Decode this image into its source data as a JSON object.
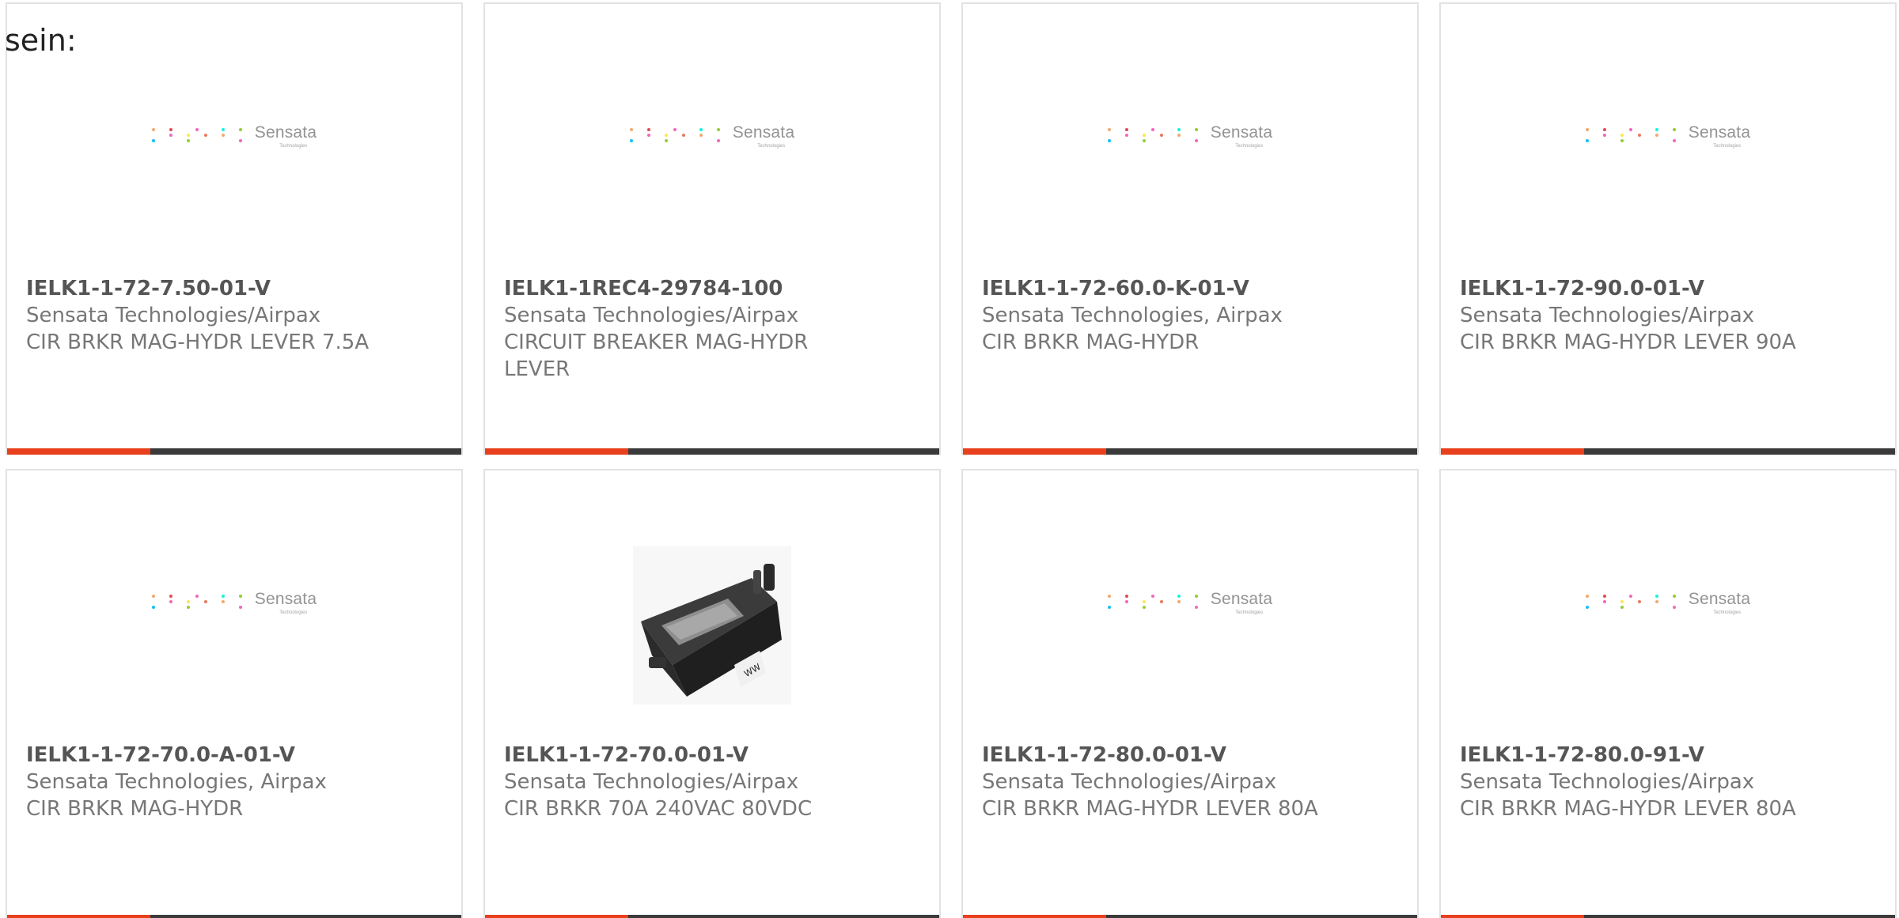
{
  "intro_text": "sein:",
  "brand_logo": {
    "name": "Sensata",
    "subtitle": "Technologies"
  },
  "colors": {
    "accent": "#e8401c",
    "bar": "#3a3a3a",
    "card_border": "#e2e2e2",
    "part_number": "#555555",
    "text_muted": "#777777"
  },
  "products": [
    {
      "part_number": "IELK1-1-72-7.50-01-V",
      "manufacturer": "Sensata Technologies/Airpax",
      "description": "CIR BRKR MAG-HYDR LEVER 7.5A",
      "image": "sensata-logo"
    },
    {
      "part_number": "IELK1-1REC4-29784-100",
      "manufacturer": "Sensata Technologies/Airpax",
      "description": "CIRCUIT BREAKER MAG-HYDR LEVER",
      "image": "sensata-logo"
    },
    {
      "part_number": "IELK1-1-72-60.0-K-01-V",
      "manufacturer": "Sensata Technologies, Airpax",
      "description": "CIR BRKR MAG-HYDR",
      "image": "sensata-logo"
    },
    {
      "part_number": "IELK1-1-72-90.0-01-V",
      "manufacturer": "Sensata Technologies/Airpax",
      "description": "CIR BRKR MAG-HYDR LEVER 90A",
      "image": "sensata-logo"
    },
    {
      "part_number": "IELK1-1-72-70.0-A-01-V",
      "manufacturer": "Sensata Technologies, Airpax",
      "description": "CIR BRKR MAG-HYDR",
      "image": "sensata-logo"
    },
    {
      "part_number": "IELK1-1-72-70.0-01-V",
      "manufacturer": "Sensata Technologies/Airpax",
      "description": "CIR BRKR 70A 240VAC 80VDC",
      "image": "circuit-breaker-photo"
    },
    {
      "part_number": "IELK1-1-72-80.0-01-V",
      "manufacturer": "Sensata Technologies/Airpax",
      "description": "CIR BRKR MAG-HYDR LEVER 80A",
      "image": "sensata-logo"
    },
    {
      "part_number": "IELK1-1-72-80.0-91-V",
      "manufacturer": "Sensata Technologies/Airpax",
      "description": "CIR BRKR MAG-HYDR LEVER 80A",
      "image": "sensata-logo"
    }
  ]
}
